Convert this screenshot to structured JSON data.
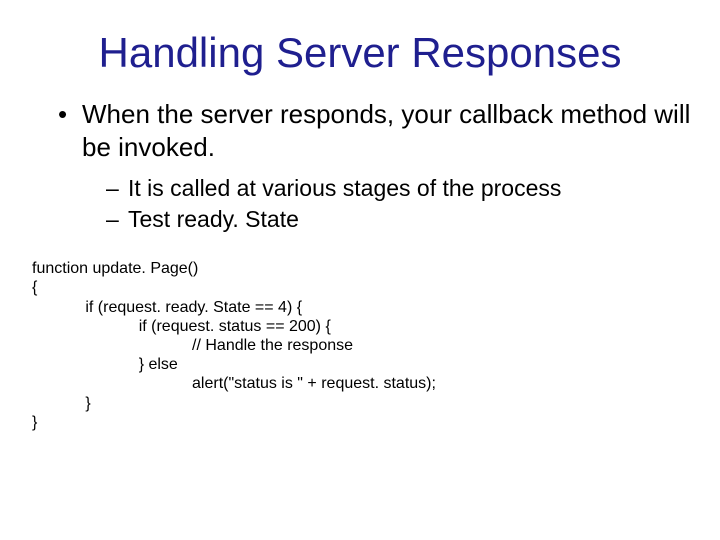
{
  "title": "Handling Server Responses",
  "bullets": {
    "l1_0": "When the server responds, your callback method will be invoked.",
    "l2_0": "It is called at various stages of the process",
    "l2_1": "Test ready. State"
  },
  "code": {
    "l0": "function update. Page()",
    "l1": "{",
    "l2": "            if (request. ready. State == 4) {",
    "l3": "                        if (request. status == 200) {",
    "l4": "                                    // Handle the response",
    "l5": "                        } else",
    "l6": "                                    alert(\"status is \" + request. status);",
    "l7": "            }",
    "l8": "}"
  }
}
